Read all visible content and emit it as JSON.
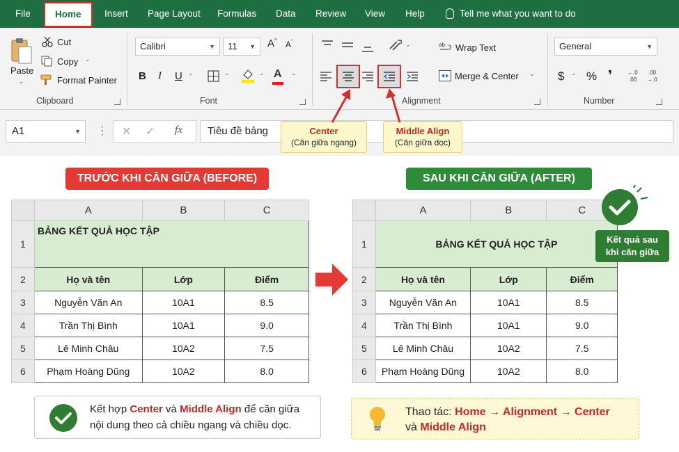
{
  "tabs": [
    {
      "label": "File"
    },
    {
      "label": "Home"
    },
    {
      "label": "Insert"
    },
    {
      "label": "Page Layout"
    },
    {
      "label": "Formulas"
    },
    {
      "label": "Data"
    },
    {
      "label": "Review"
    },
    {
      "label": "View"
    },
    {
      "label": "Help"
    }
  ],
  "tell_me": "Tell me what you want to do",
  "clipboard": {
    "paste": "Paste",
    "cut": "Cut",
    "copy": "Copy",
    "format_painter": "Format Painter",
    "group": "Clipboard"
  },
  "font": {
    "name": "Calibri",
    "size": "11",
    "bold": "B",
    "italic": "I",
    "underline": "U",
    "color_letter": "A",
    "group": "Font"
  },
  "alignment": {
    "wrap_text": "Wrap Text",
    "merge_center": "Merge & Center",
    "group": "Alignment"
  },
  "number": {
    "format": "General",
    "currency": "$",
    "percent": "%",
    "comma": "❜",
    "inc_dec": "+.0\n.00",
    "dec_dec": ".00\n→.0",
    "group": "Number"
  },
  "formula_bar": {
    "cell_ref": "A1",
    "fx": "fx",
    "value": "Tiêu đề bảng"
  },
  "callouts": {
    "center_title": "Center",
    "center_sub": "(Căn giữa ngang)",
    "middle_title": "Middle Align",
    "middle_sub": "(Căn giữa dọc)"
  },
  "sections": {
    "before": "TRƯỚC KHI CĂN GIỮA (BEFORE)",
    "after": "SAU KHI CĂN GIỮA (AFTER)"
  },
  "sheet": {
    "columns": [
      "A",
      "B",
      "C"
    ],
    "row_numbers": [
      "1",
      "2",
      "3",
      "4",
      "5",
      "6"
    ],
    "title": "BẢNG KẾT QUẢ HỌC TẬP",
    "headers": [
      "Họ và tên",
      "Lớp",
      "Điểm"
    ],
    "rows": [
      [
        "Nguyễn Văn An",
        "10A1",
        "8.5"
      ],
      [
        "Trần Thị Bình",
        "10A1",
        "9.0"
      ],
      [
        "Lê Minh Châu",
        "10A2",
        "7.5"
      ],
      [
        "Phạm Hoàng Dũng",
        "10A2",
        "8.0"
      ]
    ]
  },
  "result_tag": {
    "line1": "Kết quả sau",
    "line2": "khi căn giữa"
  },
  "note_left": {
    "t1": "Kết hợp ",
    "center": "Center",
    "t2": " và ",
    "middle": "Middle Align",
    "t3": " để căn giữa",
    "t4": "nội dung theo cả chiều ngang và chiều dọc."
  },
  "note_right": {
    "t1": "Thao tác: ",
    "path": "Home → Alignment → Center",
    "t2": "và ",
    "middle": "Middle Align"
  },
  "colors": {
    "excel_green": "#1d6f42",
    "red": "#d32f2f",
    "header_green": "#d8ecd2",
    "badge_green": "#2e7d32"
  }
}
